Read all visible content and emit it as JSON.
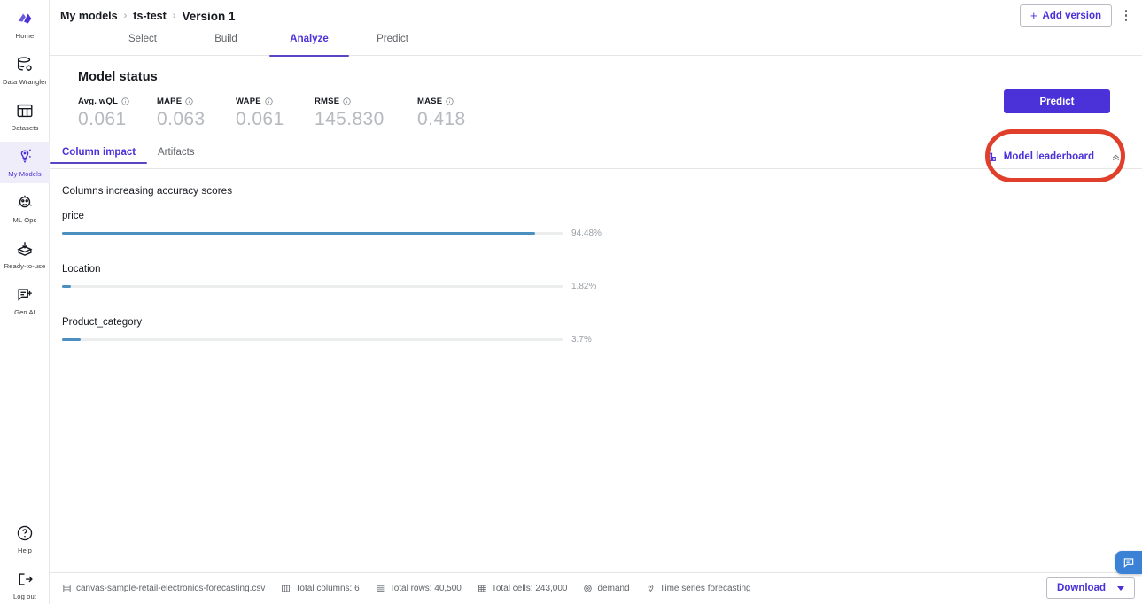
{
  "sidebar": {
    "items": [
      {
        "label": "Home",
        "icon": "home-logo-icon",
        "active": false
      },
      {
        "label": "Data Wrangler",
        "icon": "data-wrangler-icon",
        "active": false
      },
      {
        "label": "Datasets",
        "icon": "datasets-icon",
        "active": false
      },
      {
        "label": "My Models",
        "icon": "my-models-icon",
        "active": true
      },
      {
        "label": "ML Ops",
        "icon": "ml-ops-icon",
        "active": false
      },
      {
        "label": "Ready-to-use",
        "icon": "ready-to-use-icon",
        "active": false
      },
      {
        "label": "Gen AI",
        "icon": "gen-ai-icon",
        "active": false
      }
    ],
    "bottom_items": [
      {
        "label": "Help",
        "icon": "help-circle-icon"
      },
      {
        "label": "Log out",
        "icon": "logout-icon"
      }
    ]
  },
  "header": {
    "breadcrumb": [
      {
        "label": "My models"
      },
      {
        "label": "ts-test"
      },
      {
        "label": "Version 1"
      }
    ],
    "separator": "›",
    "add_version_label": "Add version",
    "add_version_plus": "+",
    "kebab_icon": "more-options-icon"
  },
  "steps": [
    {
      "label": "Select",
      "x": 105,
      "active": false
    },
    {
      "label": "Build",
      "x": 199,
      "active": false
    },
    {
      "label": "Analyze",
      "x": 293,
      "active": true
    },
    {
      "label": "Predict",
      "x": 387,
      "active": false
    }
  ],
  "model_status": {
    "title": "Model status",
    "predict_button": "Predict",
    "metrics": [
      {
        "name": "Avg. wQL",
        "value": "0.061"
      },
      {
        "name": "MAPE",
        "value": "0.063"
      },
      {
        "name": "WAPE",
        "value": "0.061"
      },
      {
        "name": "RMSE",
        "value": "145.830"
      },
      {
        "name": "MASE",
        "value": "0.418"
      }
    ]
  },
  "content_tabs": [
    {
      "label": "Column impact",
      "x": 14,
      "active": true
    },
    {
      "label": "Artifacts",
      "x": 122,
      "active": false
    }
  ],
  "leaderboard": {
    "label": "Model leaderboard",
    "icon": "bar-chart-icon",
    "chevron": "chevron-up-icon"
  },
  "column_impact": {
    "title": "Columns increasing accuracy scores"
  },
  "chart_data": {
    "type": "bar",
    "title": "Columns increasing accuracy scores",
    "orientation": "horizontal",
    "categories": [
      "price",
      "Location",
      "Product_category"
    ],
    "values": [
      94.48,
      1.82,
      3.7
    ],
    "labels": [
      "94.48%",
      "1.82%",
      "3.7%"
    ],
    "xlabel": "",
    "ylabel": "",
    "xlim": [
      0,
      100
    ],
    "grid": false,
    "legend": null,
    "bar_color": "#4a8fc0",
    "track_color": "#eceded"
  },
  "footer": {
    "chips": [
      {
        "icon": "file-table-icon",
        "label": "canvas-sample-retail-electronics-forecasting.csv"
      },
      {
        "icon": "columns-icon",
        "label": "Total columns: 6"
      },
      {
        "icon": "rows-icon",
        "label": "Total rows: 40,500"
      },
      {
        "icon": "cells-icon",
        "label": "Total cells: 243,000"
      },
      {
        "icon": "target-icon",
        "label": "demand"
      },
      {
        "icon": "forecast-icon",
        "label": "Time series forecasting"
      }
    ],
    "download_label": "Download"
  },
  "chat": {
    "icon": "chat-bubble-icon"
  },
  "annotation": {
    "shape": "ellipse",
    "color": "#e0402b",
    "target": "Model leaderboard"
  },
  "colors": {
    "accent": "#4a31d8",
    "tab_underline": "#5b45c6",
    "bar": "#4a8fc0",
    "annotation": "#e0402b",
    "chat": "#3b82d6"
  }
}
